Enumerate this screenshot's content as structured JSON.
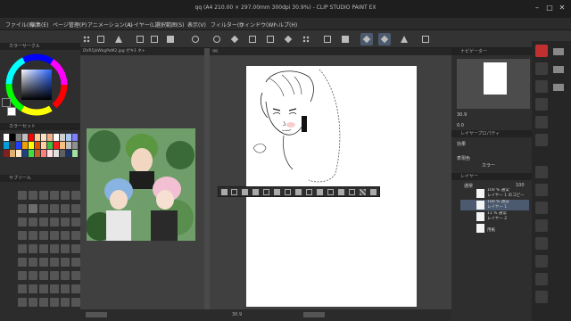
{
  "window": {
    "title": "qq (A4 210.00 × 297.00mm 300dpi 30.9%) - CLIP STUDIO PAINT EX"
  },
  "menu": [
    "ファイル(F)",
    "編集(E)",
    "ページ管理(P)",
    "アニメーション(A)",
    "レイヤー(L)",
    "選択範囲(S)",
    "表示(V)",
    "フィルター(I)",
    "ウィンドウ(W)",
    "ヘルプ(H)"
  ],
  "panels": {
    "color_wheel": "カラーサークル",
    "color_set": "カラーセット",
    "subtool": "サブツール",
    "navigator": "ナビゲーター",
    "layer_property": "レイヤープロパティ",
    "layer": "レイヤー"
  },
  "documents": {
    "reference_tab": "DVR5jkWkgPaM2.jpg",
    "reference_tab2": "ゼキ1 ネ+",
    "main_tab": "qq"
  },
  "navigator": {
    "zoom": "30.9",
    "angle": "0.0"
  },
  "layer_property": {
    "effect_label": "効果",
    "expression_color_label": "表現色",
    "expression_color_value": "カラー"
  },
  "layer_panel": {
    "blend_mode": "通常",
    "opacity": "100",
    "layers": [
      {
        "line1": "100 % 通常",
        "line2": "レイヤー 1 のコピー",
        "selected": false
      },
      {
        "line1": "100 % 通常",
        "line2": "レイヤー 1",
        "selected": true
      },
      {
        "line1": "11 % 通常",
        "line2": "レイヤー 2",
        "selected": false
      },
      {
        "line1": "",
        "line2": "用紙",
        "selected": false
      }
    ]
  },
  "colors": {
    "accent": "#4b5a6e",
    "main_color": "#2a2a2a",
    "sub_color": "#ffffff",
    "swatches": [
      "#ffffff",
      "#000000",
      "#808080",
      "#c0c0c0",
      "#ff0000",
      "#ffcc99",
      "#ffe0c0",
      "#f4b08a",
      "#ffffff",
      "#d0d0d0",
      "#a8c8f0",
      "#8080ff",
      "#00a0e0",
      "#404040",
      "#2040ff",
      "#f0a000",
      "#ffff00",
      "#e05000",
      "#ffd0a0",
      "#40c040",
      "#f02020",
      "#f8c080",
      "#c0c0c0",
      "#909090",
      "#802020",
      "#e0b070",
      "#ffe8c8",
      "#204080",
      "#40e040",
      "#c06020",
      "#ff8080",
      "#ffe0e0",
      "#e0e0e0",
      "#606060",
      "#203060",
      "#a0e0a0"
    ]
  }
}
